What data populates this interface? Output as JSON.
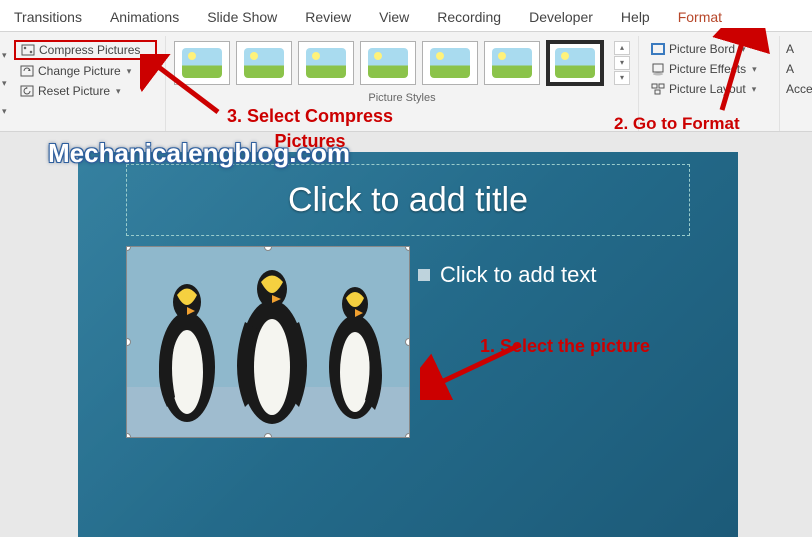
{
  "tabs": {
    "items": [
      "Transitions",
      "Animations",
      "Slide Show",
      "Review",
      "View",
      "Recording",
      "Developer",
      "Help",
      "Format"
    ],
    "active_index": 8
  },
  "adjust": {
    "compress": "Compress Pictures",
    "change": "Change Picture",
    "reset": "Reset Picture"
  },
  "styles": {
    "label": "Picture Styles"
  },
  "format": {
    "border": "Picture Bord",
    "effects": "Picture Effects",
    "layout": "Picture Layout"
  },
  "right": {
    "a1": "A",
    "a2": "A",
    "acc": "Acce"
  },
  "slide": {
    "title_placeholder": "Click to add title",
    "content_placeholder": "Click to add text"
  },
  "watermark": "Mechanicalengblog.com",
  "annotations": {
    "step1": "1.  Select the picture",
    "step2": "2. Go to Format",
    "step3": "3. Select Compress Pictures"
  }
}
